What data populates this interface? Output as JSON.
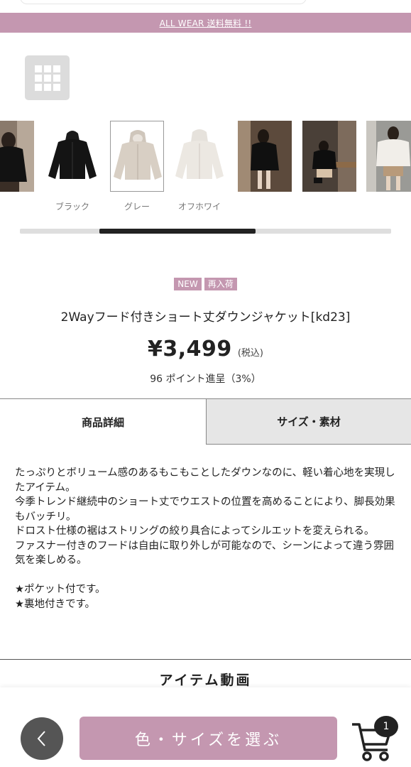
{
  "banner": {
    "text": "ALL WEAR 送料無料 !!"
  },
  "grid_button": {
    "icon": "grid-icon"
  },
  "thumbnails": [
    {
      "name": "model-photo-1",
      "label": ""
    },
    {
      "name": "color-black",
      "label": "ブラック"
    },
    {
      "name": "color-gray",
      "label": "グレー",
      "selected": true
    },
    {
      "name": "color-offwhite",
      "label": "オフホワイ"
    },
    {
      "name": "model-photo-2",
      "label": ""
    },
    {
      "name": "model-photo-3",
      "label": ""
    },
    {
      "name": "model-photo-4",
      "label": ""
    }
  ],
  "product": {
    "badges": [
      "NEW",
      "再入荷"
    ],
    "title": "2Wayフード付きショート丈ダウンジャケット[kd23]",
    "price": "¥3,499",
    "tax_note": "(税込)",
    "points": "96 ポイント進呈（3%）"
  },
  "tabs": [
    {
      "label": "商品詳細",
      "active": true
    },
    {
      "label": "サイズ・素材",
      "active": false
    }
  ],
  "description": {
    "lines": [
      "たっぷりとボリューム感のあるもこもことしたダウンなのに、軽い着心地を実現したアイテム。",
      "今季トレンド継続中のショート丈でウエストの位置を高めることにより、脚長効果もバッチリ。",
      "ドロスト仕様の裾はストリングの絞り具合によってシルエットを変えられる。",
      "ファスナー付きのフードは自由に取り外しが可能なので、シーンによって違う雰囲気を楽しめる。",
      "",
      "★ポケット付です。",
      "★裏地付きです。"
    ]
  },
  "video_section": {
    "heading": "アイテム動画"
  },
  "bottom_bar": {
    "choose_button": "色・サイズを選ぶ",
    "cart_count": "1"
  },
  "colors": {
    "accent": "#c497b0",
    "tab_inactive": "#e6e6e6",
    "back_button": "#555555"
  }
}
